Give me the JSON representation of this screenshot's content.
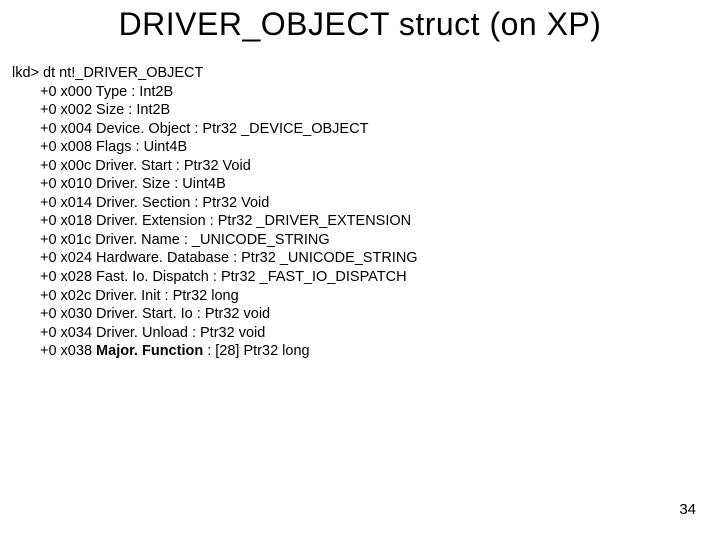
{
  "title": "DRIVER_OBJECT struct (on XP)",
  "command": "lkd> dt nt!_DRIVER_OBJECT",
  "fields": [
    {
      "offset": "+0 x000",
      "name": "Type",
      "type": ": Int2B"
    },
    {
      "offset": "+0 x002",
      "name": "Size",
      "type": ": Int2B"
    },
    {
      "offset": "+0 x004",
      "name": "Device. Object",
      "type": ": Ptr32 _DEVICE_OBJECT"
    },
    {
      "offset": "+0 x008",
      "name": "Flags",
      "type": ": Uint4B"
    },
    {
      "offset": "+0 x00c",
      "name": "Driver. Start",
      "type": ": Ptr32 Void"
    },
    {
      "offset": "+0 x010",
      "name": "Driver. Size",
      "type": ": Uint4B"
    },
    {
      "offset": "+0 x014",
      "name": "Driver. Section",
      "type": ": Ptr32 Void"
    },
    {
      "offset": "+0 x018",
      "name": "Driver. Extension",
      "type": ": Ptr32 _DRIVER_EXTENSION"
    },
    {
      "offset": "+0 x01c",
      "name": "Driver. Name",
      "type": ": _UNICODE_STRING"
    },
    {
      "offset": "+0 x024",
      "name": "Hardware. Database",
      "type": ": Ptr32 _UNICODE_STRING"
    },
    {
      "offset": "+0 x028",
      "name": "Fast. Io. Dispatch",
      "type": ": Ptr32 _FAST_IO_DISPATCH"
    },
    {
      "offset": "+0 x02c",
      "name": "Driver. Init",
      "type": ": Ptr32     long"
    },
    {
      "offset": "+0 x030",
      "name": "Driver. Start. Io",
      "type": ": Ptr32     void"
    },
    {
      "offset": "+0 x034",
      "name": "Driver. Unload",
      "type": ": Ptr32     void"
    },
    {
      "offset": "+0 x038",
      "name": "Major. Function",
      "type": ": [28] Ptr32     long",
      "bold": true
    }
  ],
  "page_number": "34"
}
